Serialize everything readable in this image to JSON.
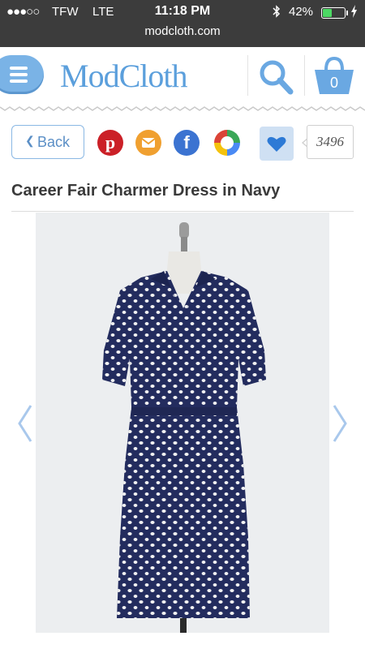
{
  "status_bar": {
    "signal": "●●●○○",
    "carrier": "TFW",
    "network": "LTE",
    "time": "11:18 PM",
    "battery_percent": "42%",
    "battery_level": 0.42,
    "url": "modcloth.com"
  },
  "header": {
    "logo": "ModCloth",
    "cart_count": "0",
    "brand_color": "#5b9fdc"
  },
  "share": {
    "back_label": "Back",
    "pinterest_letter": "p",
    "facebook_letter": "f",
    "like_count": "3496"
  },
  "product": {
    "title": "Career Fair Charmer Dress in Navy",
    "dress_color": "#232c5e"
  },
  "icons": [
    "menu-icon",
    "search-icon",
    "cart-icon",
    "chevron-left-icon",
    "pinterest-icon",
    "email-icon",
    "facebook-icon",
    "google-icon",
    "heart-icon",
    "arrow-left-icon",
    "arrow-right-icon"
  ]
}
